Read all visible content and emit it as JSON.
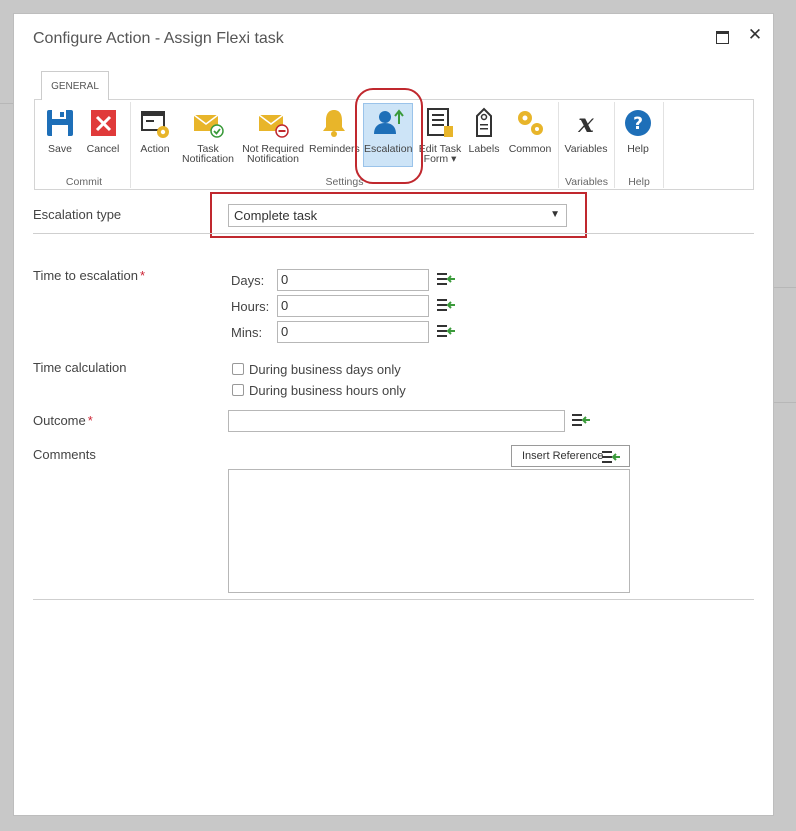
{
  "dialog": {
    "title": "Configure Action - Assign Flexi task"
  },
  "ribbon": {
    "tab": "GENERAL",
    "buttons": {
      "save": "Save",
      "cancel": "Cancel",
      "action": "Action",
      "task_notification_1": "Task",
      "task_notification_2": "Notification",
      "not_required_1": "Not Required",
      "not_required_2": "Notification",
      "reminders": "Reminders",
      "escalation": "Escalation",
      "edit_task_form_1": "Edit Task",
      "edit_task_form_2": "Form ▾",
      "labels": "Labels",
      "common": "Common",
      "variables": "Variables",
      "help": "Help"
    },
    "groups": {
      "commit": "Commit",
      "settings": "Settings",
      "variables": "Variables",
      "help": "Help"
    }
  },
  "form": {
    "escalation_type_label": "Escalation type",
    "escalation_type_value": "Complete task",
    "time_to_escalation_label": "Time to escalation",
    "required_mark": "*",
    "days_label": "Days:",
    "days_value": "0",
    "hours_label": "Hours:",
    "hours_value": "0",
    "mins_label": "Mins:",
    "mins_value": "0",
    "time_calculation_label": "Time calculation",
    "business_days": "During business days only",
    "business_hours": "During business hours only",
    "outcome_label": "Outcome",
    "outcome_value": "",
    "comments_label": "Comments",
    "insert_reference": "Insert Reference"
  },
  "colors": {
    "highlight": "#c0282e",
    "selected_bg": "#cde4f7",
    "icon_blue": "#1e6fb8",
    "icon_yellow": "#e8b52a",
    "icon_red": "#e03a3a",
    "icon_green": "#3a9a3a"
  },
  "icons": {
    "save": "floppy-disk-icon",
    "cancel": "red-x-icon",
    "action": "window-gear-icon",
    "task_notification": "envelope-check-icon",
    "not_required": "envelope-minus-icon",
    "reminders": "bell-icon",
    "escalation": "person-up-arrow-icon",
    "edit_task_form": "form-edit-icon",
    "labels": "tag-icon",
    "common": "gears-icon",
    "variables": "x-variable-icon",
    "help": "help-circle-icon",
    "insert_reference": "insert-reference-icon"
  }
}
